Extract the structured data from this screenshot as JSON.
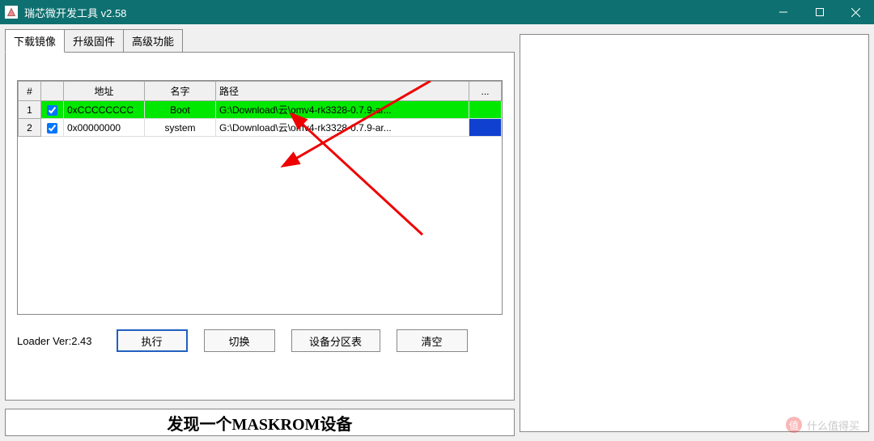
{
  "titlebar": {
    "title": "瑞芯微开发工具 v2.58"
  },
  "tabs": {
    "download": "下载镜像",
    "upgrade": "升级固件",
    "advanced": "高级功能"
  },
  "table": {
    "headers": {
      "num": "#",
      "chk": "",
      "addr": "地址",
      "name": "名字",
      "path": "路径",
      "ell": "..."
    },
    "rows": [
      {
        "num": "1",
        "checked": true,
        "addr": "0xCCCCCCCC",
        "name": "Boot",
        "path": "G:\\Download\\云\\omv4-rk3328-0.7.9-ar...",
        "highlight": "green"
      },
      {
        "num": "2",
        "checked": true,
        "addr": "0x00000000",
        "name": "system",
        "path": "G:\\Download\\云\\omv4-rk3328-0.7.9-ar...",
        "highlight": "blue-cell"
      }
    ]
  },
  "footer": {
    "loader": "Loader Ver:2.43",
    "execute": "执行",
    "switch": "切换",
    "partition": "设备分区表",
    "clear": "清空"
  },
  "status": {
    "message": "发现一个MASKROM设备"
  },
  "watermark": {
    "text": "什么值得买"
  }
}
